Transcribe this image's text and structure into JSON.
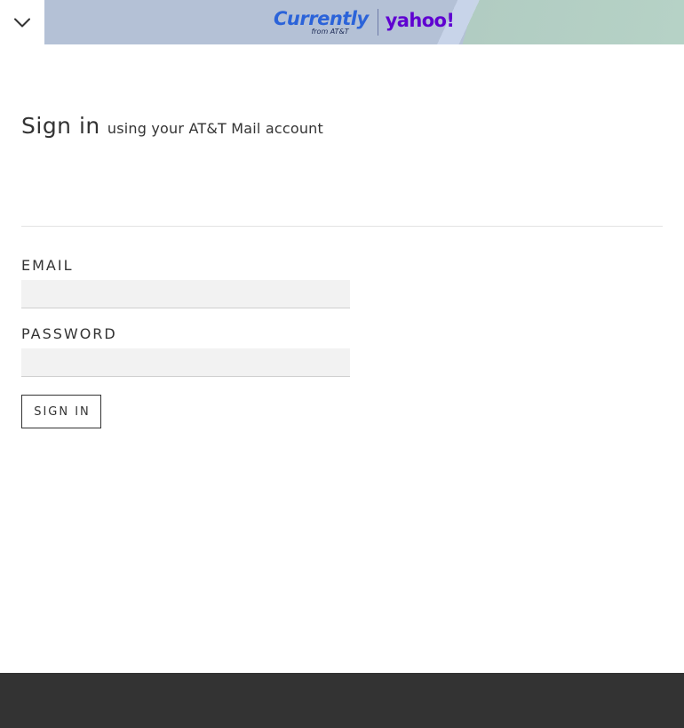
{
  "header": {
    "collapse_icon": "chevron-down-icon",
    "brand_currently": "Currently",
    "brand_currently_sub": "from AT&T",
    "brand_yahoo": "yahoo!"
  },
  "page": {
    "title": "Sign in",
    "subtitle": "using your AT&T Mail account"
  },
  "form": {
    "email_label": "EMAIL",
    "email_value": "",
    "password_label": "PASSWORD",
    "password_value": "",
    "submit_label": "SIGN IN"
  },
  "colors": {
    "banner_blue": "#b4c1d6",
    "banner_green": "#b6d2c6",
    "currently_blue": "#2b63d9",
    "yahoo_purple": "#5f01d1",
    "text": "#333333",
    "field_bg": "#f2f2f2",
    "footer": "#333333"
  }
}
